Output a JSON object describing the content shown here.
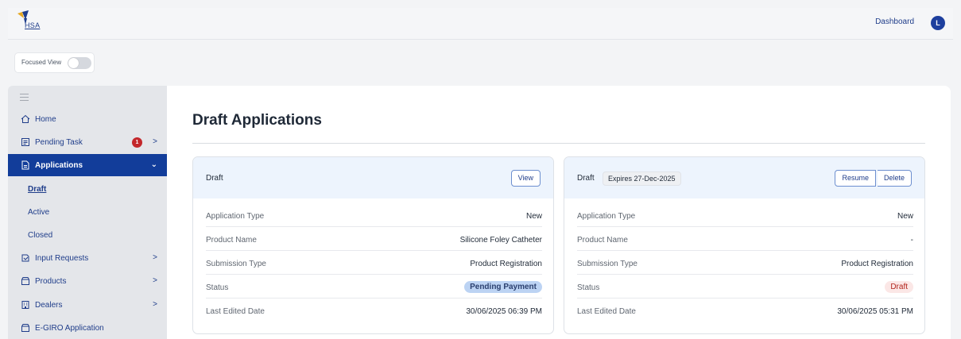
{
  "header": {
    "logo_text": "HSA",
    "dashboard_link": "Dashboard",
    "avatar_initial": "L"
  },
  "focused_view": {
    "label": "Focused View",
    "enabled": false
  },
  "sidebar": {
    "items": [
      {
        "label": "Home",
        "icon": "home-icon"
      },
      {
        "label": "Pending Task",
        "icon": "task-icon",
        "badge": "1"
      },
      {
        "label": "Applications",
        "icon": "document-icon",
        "active": true
      },
      {
        "label": "Input Requests",
        "icon": "input-request-icon"
      },
      {
        "label": "Products",
        "icon": "box-icon"
      },
      {
        "label": "Dealers",
        "icon": "building-icon"
      },
      {
        "label": "E-GIRO Application",
        "icon": "box-icon"
      }
    ],
    "sub_items": [
      {
        "label": "Draft",
        "current": true
      },
      {
        "label": "Active"
      },
      {
        "label": "Closed"
      }
    ]
  },
  "main": {
    "title": "Draft Applications",
    "cards": [
      {
        "kind": "Draft",
        "buttons": [
          "View"
        ],
        "rows": [
          {
            "label": "Application Type",
            "value": "New"
          },
          {
            "label": "Product Name",
            "value": "Silicone Foley Catheter"
          },
          {
            "label": "Submission Type",
            "value": "Product Registration"
          },
          {
            "label": "Status",
            "value": "Pending Payment"
          },
          {
            "label": "Last Edited Date",
            "value": "30/06/2025 06:39 PM"
          }
        ]
      },
      {
        "kind": "Draft",
        "expiry": "Expires 27-Dec-2025",
        "buttons": [
          "Resume",
          "Delete"
        ],
        "rows": [
          {
            "label": "Application Type",
            "value": "New"
          },
          {
            "label": "Product Name",
            "value": "-"
          },
          {
            "label": "Submission Type",
            "value": "Product Registration"
          },
          {
            "label": "Status",
            "value": "Draft"
          },
          {
            "label": "Last Edited Date",
            "value": "30/06/2025 05:31 PM"
          }
        ]
      }
    ]
  },
  "colors": {
    "primary": "#123d9a",
    "badge_red": "#c3272b",
    "pending_pill": "#bcd3f3",
    "draft_pill": "#fbe7e6"
  }
}
